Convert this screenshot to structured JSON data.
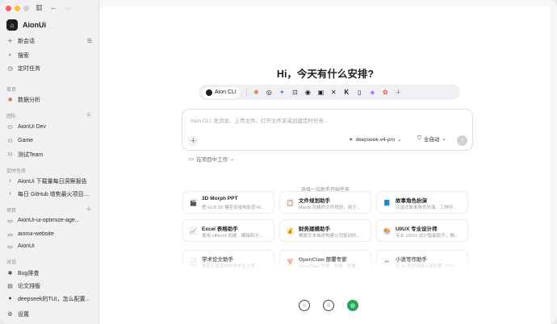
{
  "app": {
    "name": "AionUi"
  },
  "sidebar": {
    "new_chat": "新会话",
    "search": "搜索",
    "scheduled": "定时任务",
    "section_home": "首页",
    "data_analysis": "数据分析",
    "section_team": "团队",
    "teams": [
      "AionUi Dev",
      "Game",
      "测试Team"
    ],
    "section_scheduled": "定时任务",
    "scheduled_items": [
      "AionUi 下载量每日洞察报告",
      "每日 GitHub 增势最火项目洞..."
    ],
    "section_projects": "项目",
    "projects": [
      "AionUi-ui-optimize-age...",
      "aionui-website",
      "AionUi"
    ],
    "section_chats": "对话",
    "chats": [
      "Bug排查",
      "论文排版",
      "deepseek的TUI，怎么配置..."
    ],
    "settings": "设置"
  },
  "main": {
    "greeting": "Hi，今天有什么安排?",
    "active_agent": "Aion CLI",
    "agent_icons": [
      "claude-icon",
      "openai-icon",
      "gemini-icon",
      "robot-icon",
      "github-icon",
      "cursor-icon",
      "x-icon",
      "kimi-icon",
      "codex-icon",
      "qwen-icon",
      "custom-agent-icon",
      "add-icon"
    ],
    "input_placeholder": "Aion CLI, 发消息、上传文件、打开文件夹或创建定时任务...",
    "model": "deepseek-v4-pro",
    "mode": "全自动",
    "workspace": "在项目中工作",
    "pick_title": "选择一位助手开始任务",
    "assistants": [
      {
        "title": "3D Morph PPT",
        "desc": "把 GLB 3D 模型变成电影感 M...",
        "icon": "🎬"
      },
      {
        "title": "文件规划助手",
        "desc": "Marus 风格的文件规划，用于...",
        "icon": "📋"
      },
      {
        "title": "故事角色扮演",
        "desc": "沉浸式故事角色扮演，三种开...",
        "icon": "📘"
      },
      {
        "title": "Excel 表格助手",
        "desc": "使用 officecli 创建、编辑和分...",
        "icon": "📈"
      },
      {
        "title": "财务建模助手",
        "desc": "根据文本描述构建公司驱动的...",
        "icon": "💰"
      },
      {
        "title": "UI/UX 专业设计师",
        "desc": "专业 UI/UX 设计智能助手，拥...",
        "icon": "🎨"
      },
      {
        "title": "学术论文助手",
        "desc": "使用生成高效的学术论文写...",
        "icon": "📄"
      },
      {
        "title": "OpenClaw 部署专家",
        "desc": "OpenClaw 安装、部署、配置...",
        "icon": "🦞"
      },
      {
        "title": "小说写作助手",
        "desc": "让 AI 写好网络小说的第一个小...",
        "icon": "✏"
      }
    ]
  },
  "colors": {
    "accent_green": "#23a55a",
    "red": "#ff5f57",
    "yellow": "#febc2e",
    "grey": "#d0d0d4"
  }
}
